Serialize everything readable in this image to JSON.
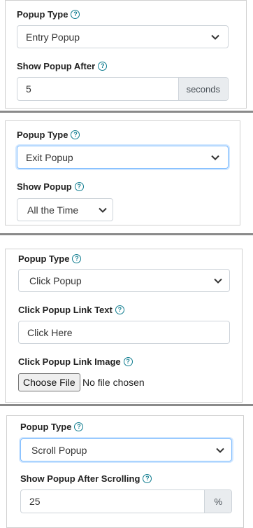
{
  "panels": [
    {
      "type_label": "Popup Type",
      "type_value": "Entry Popup",
      "field_label": "Show Popup After",
      "field_value": "5",
      "field_addon": "seconds"
    },
    {
      "type_label": "Popup Type",
      "type_value": "Exit Popup",
      "field_label": "Show Popup",
      "field_value": "All the Time"
    },
    {
      "type_label": "Popup Type",
      "type_value": "Click Popup",
      "link_text_label": "Click Popup Link Text",
      "link_text_value": "Click Here",
      "link_image_label": "Click Popup Link Image",
      "file_button": "Choose File",
      "file_status": "No file chosen"
    },
    {
      "type_label": "Popup Type",
      "type_value": "Scroll Popup",
      "field_label": "Show Popup After Scrolling",
      "field_value": "25",
      "field_addon": "%"
    }
  ],
  "icons": {
    "help": "question-circle-icon",
    "help_glyph": "?",
    "dropdown": "chevron-down-icon"
  },
  "colors": {
    "help_icon": "#0f7c8f",
    "focus_border": "#80bdff",
    "separator": "#8a8a8a"
  }
}
